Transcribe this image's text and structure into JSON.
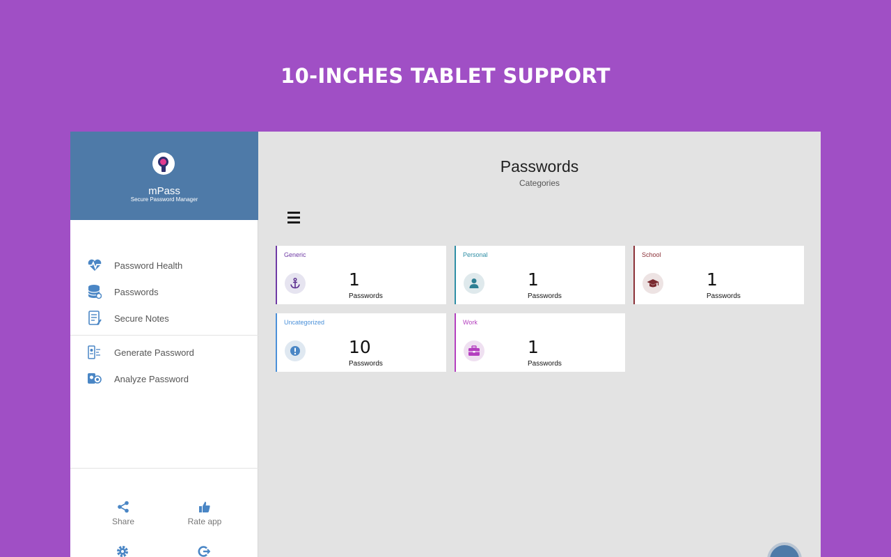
{
  "promo": {
    "title": "10-INCHES TABLET SUPPORT"
  },
  "colors": {
    "background": "#a04fc5",
    "header": "#4e7aa8",
    "main_bg": "#e3e3e3"
  },
  "drawer": {
    "app_name": "mPass",
    "app_subtitle": "Secure Password Manager",
    "nav_items": [
      {
        "label": "Password Health",
        "icon": "heartbeat-icon"
      },
      {
        "label": "Passwords",
        "icon": "database-icon"
      },
      {
        "label": "Secure Notes",
        "icon": "note-icon"
      },
      {
        "label": "Generate Password",
        "icon": "generate-icon"
      },
      {
        "label": "Analyze Password",
        "icon": "analyze-icon"
      }
    ],
    "footer": [
      {
        "label": "Share",
        "icon": "share-icon"
      },
      {
        "label": "Rate app",
        "icon": "thumbs-up-icon"
      },
      {
        "label": "",
        "icon": "gear-icon"
      },
      {
        "label": "",
        "icon": "logout-icon"
      }
    ]
  },
  "main": {
    "title": "Passwords",
    "subtitle": "Categories",
    "categories": [
      {
        "name": "Generic",
        "count": "1",
        "label": "Passwords",
        "color": "#6f3aa5",
        "icon": "anchor-icon"
      },
      {
        "name": "Personal",
        "count": "1",
        "label": "Passwords",
        "color": "#2e8ea5",
        "icon": "person-icon"
      },
      {
        "name": "School",
        "count": "1",
        "label": "Passwords",
        "color": "#8a2f36",
        "icon": "graduation-cap-icon"
      },
      {
        "name": "Uncategorized",
        "count": "10",
        "label": "Passwords",
        "color": "#4a90d9",
        "icon": "exclamation-icon"
      },
      {
        "name": "Work",
        "count": "1",
        "label": "Passwords",
        "color": "#b43fbf",
        "icon": "briefcase-icon"
      }
    ]
  }
}
